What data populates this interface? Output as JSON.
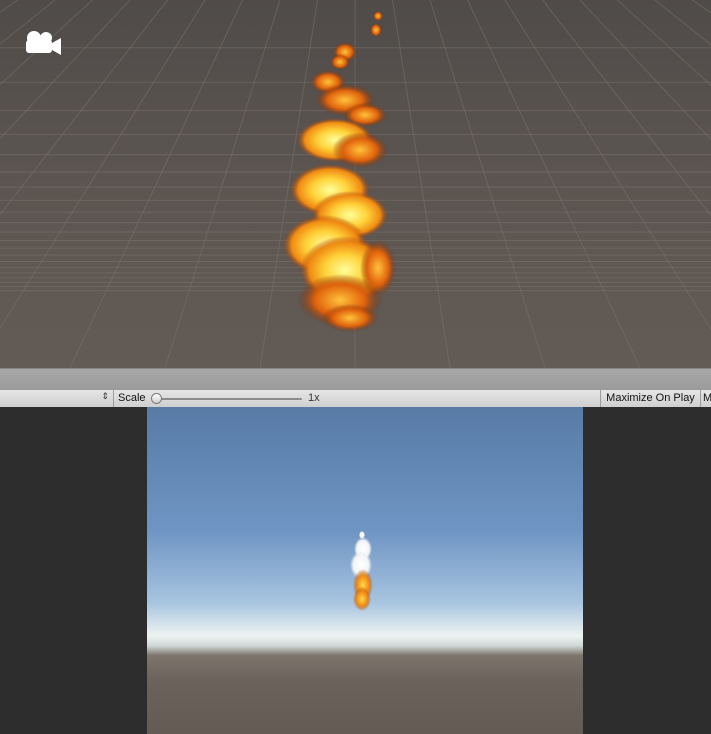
{
  "scene_view": {
    "gizmo_icon": "camera-icon",
    "effect": "fire-particle-system"
  },
  "game_toolbar": {
    "display_arrows_icon": "updown-arrows-icon",
    "scale_label": "Scale",
    "scale_value": "1x",
    "scale_level": 0.0,
    "maximize_label": "Maximize On Play",
    "clipped_label": "M"
  },
  "game_view": {
    "sky_color": "#5a7eaa",
    "ground_color": "#665d56"
  }
}
